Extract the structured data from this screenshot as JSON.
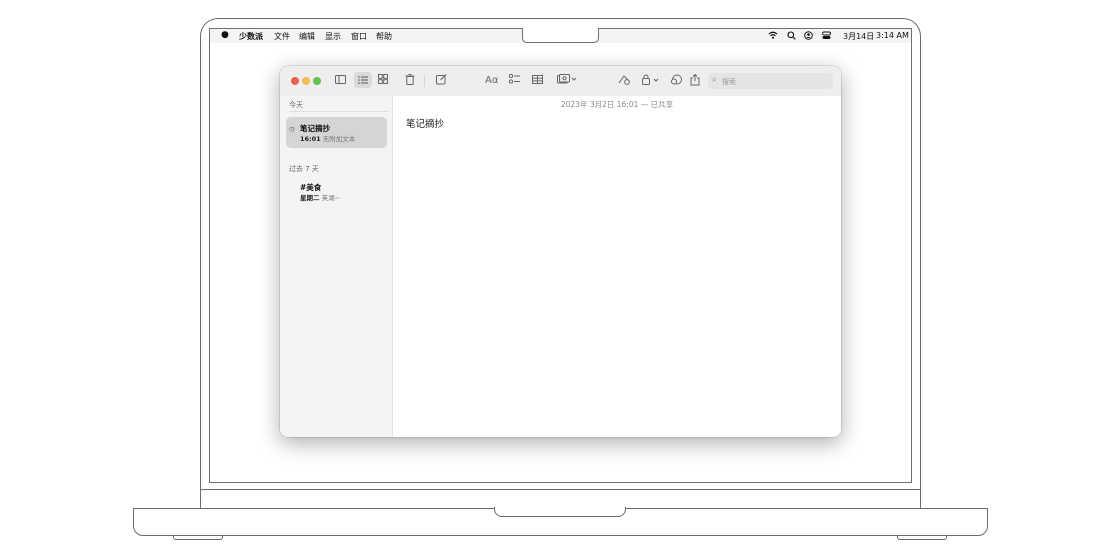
{
  "menubar": {
    "app_name": "少数派",
    "items": [
      "文件",
      "编辑",
      "显示",
      "窗口",
      "帮助"
    ],
    "date": "3月14日",
    "time": "3:14 AM"
  },
  "toolbar": {
    "search_placeholder": "搜索",
    "format_label": "Aα"
  },
  "sidebar": {
    "section_today": "今天",
    "section_past": "过去 7 天",
    "notes": [
      {
        "title": "笔记摘抄",
        "time": "16:01",
        "preview": "无附加文本",
        "pinned_icon": "clock-icon",
        "selected": true
      },
      {
        "title": "#美食",
        "time": "星期二",
        "preview": "芙湖~",
        "selected": false
      }
    ]
  },
  "editor": {
    "meta": "2023年 3月2日 16:01 — 已共享",
    "content": "笔记摘抄"
  },
  "colors": {
    "close": "#ec5f57",
    "minimize": "#f5bd4f",
    "zoom": "#61c454",
    "selection": "#d6d4d4"
  }
}
